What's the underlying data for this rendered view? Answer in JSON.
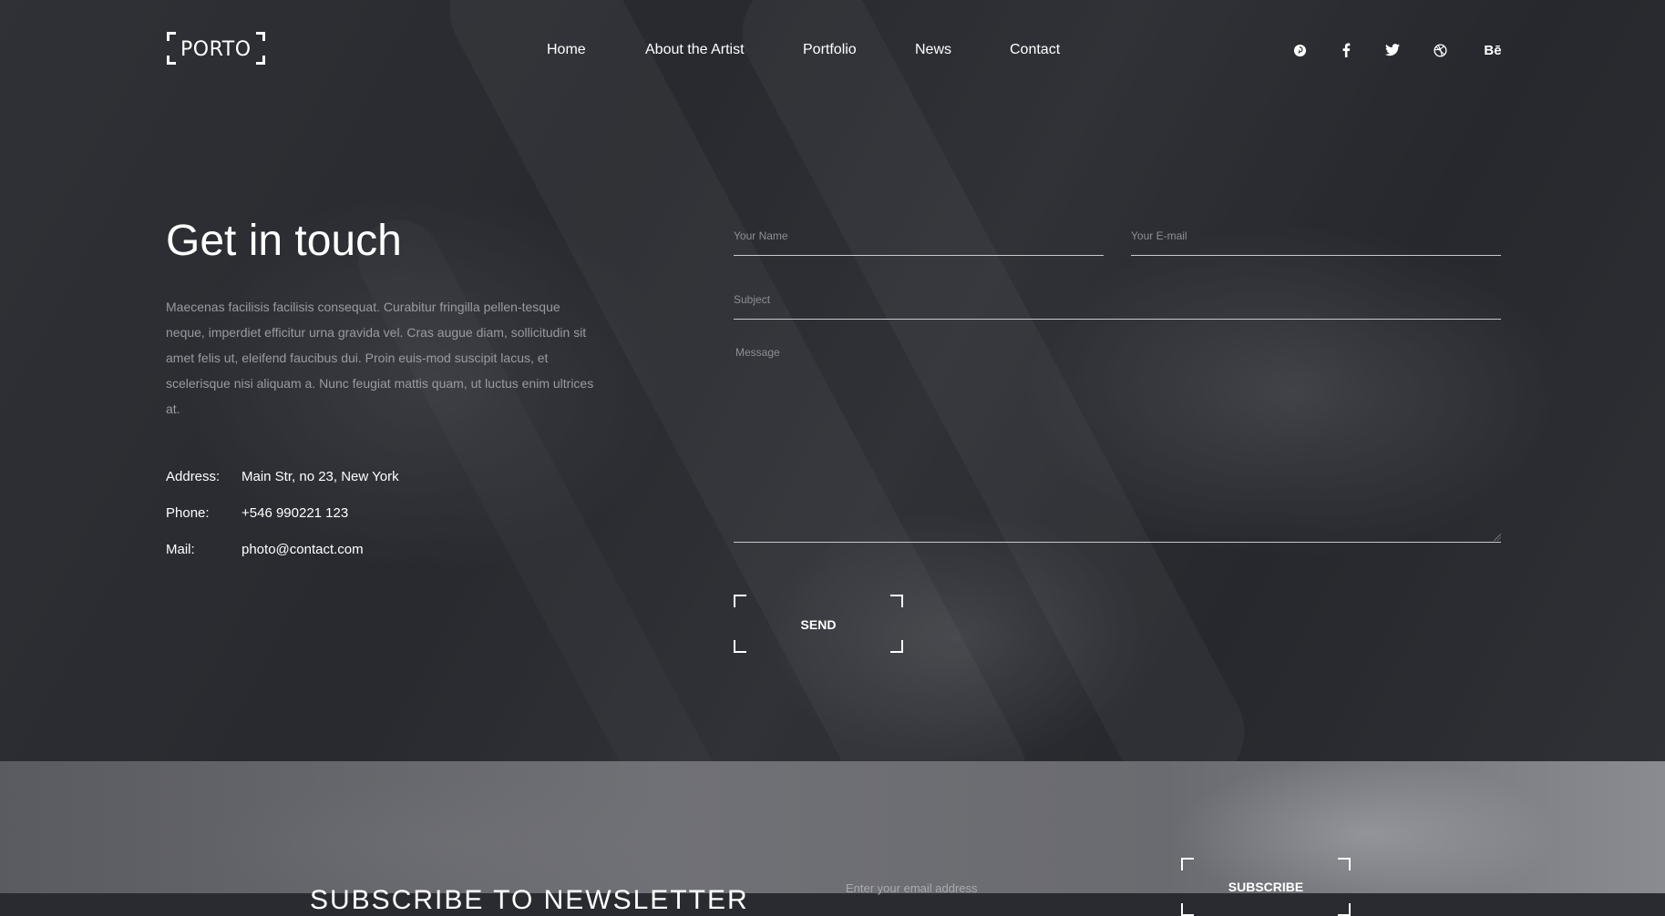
{
  "header": {
    "logo_text": "PORTO",
    "nav": [
      {
        "label": "Home"
      },
      {
        "label": "About the Artist"
      },
      {
        "label": "Portfolio"
      },
      {
        "label": "News"
      },
      {
        "label": "Contact"
      }
    ],
    "social": [
      {
        "icon": "pinterest-icon",
        "glyph": "℗"
      },
      {
        "icon": "facebook-icon",
        "glyph": "f"
      },
      {
        "icon": "twitter-icon",
        "glyph": "🐦"
      },
      {
        "icon": "dribbble-icon",
        "glyph": "⊕"
      },
      {
        "icon": "behance-icon",
        "glyph": "Bē"
      }
    ]
  },
  "contact": {
    "title": "Get in touch",
    "intro": "Maecenas facilisis facilisis consequat. Curabitur fringilla pellen-tesque neque, imperdiet efficitur urna gravida vel. Cras augue diam, sollicitudin sit amet felis ut, eleifend faucibus dui. Proin euis-mod suscipit lacus, et scelerisque nisi aliquam a. Nunc feugiat mattis quam, ut luctus enim ultrices at.",
    "address_label": "Address:",
    "address_value": "Main Str, no 23, New York",
    "phone_label": "Phone:",
    "phone_value": "+546 990221 123",
    "mail_label": "Mail:",
    "mail_value": "photo@contact.com"
  },
  "form": {
    "name_placeholder": "Your Name",
    "email_placeholder": "Your E-mail",
    "subject_placeholder": "Subject",
    "message_placeholder": "Message",
    "send_label": "SEND"
  },
  "newsletter": {
    "title": "SUBSCRIBE TO NEWSLETTER",
    "email_placeholder": "Enter your email address",
    "subscribe_label": "SUBSCRIBE"
  },
  "colors": {
    "background": "#2f3035",
    "text": "#ffffff",
    "muted_text": "#9a9aa0"
  }
}
